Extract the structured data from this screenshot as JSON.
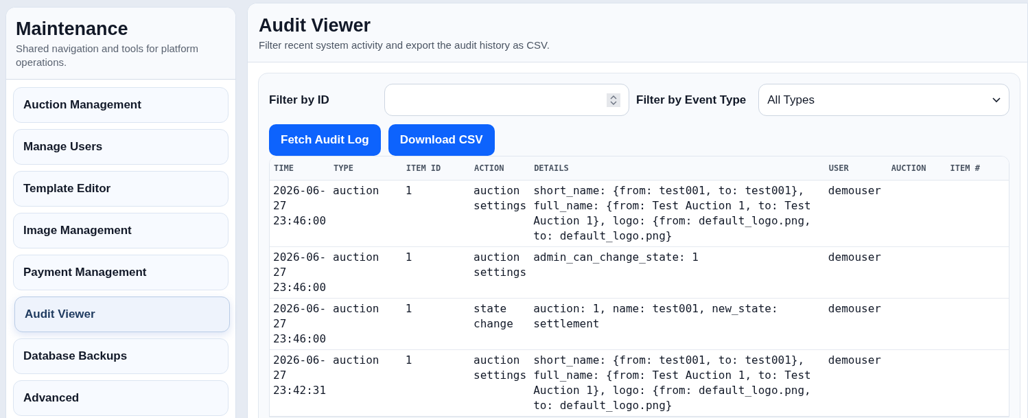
{
  "sidebar": {
    "title": "Maintenance",
    "subtitle": "Shared navigation and tools for platform operations.",
    "items": [
      {
        "label": "Auction Management",
        "selected": false
      },
      {
        "label": "Manage Users",
        "selected": false
      },
      {
        "label": "Template Editor",
        "selected": false
      },
      {
        "label": "Image Management",
        "selected": false
      },
      {
        "label": "Payment Management",
        "selected": false
      },
      {
        "label": "Audit Viewer",
        "selected": true
      },
      {
        "label": "Database Backups",
        "selected": false
      },
      {
        "label": "Advanced",
        "selected": false
      }
    ]
  },
  "page": {
    "title": "Audit Viewer",
    "subtitle": "Filter recent system activity and export the audit history as CSV."
  },
  "filters": {
    "id_label": "Filter by ID",
    "type_label": "Filter by Event Type",
    "type_value": "All Types"
  },
  "buttons": [
    "Fetch Audit Log",
    "Download CSV"
  ],
  "table": {
    "columns": [
      "TIME",
      "TYPE",
      "ITEM ID",
      "ACTION",
      "DETAILS",
      "USER",
      "AUCTION",
      "ITEM #"
    ],
    "rows": [
      [
        "2026-06-27 23:46:00",
        "auction",
        "1",
        "auction settings",
        "short_name: {from: test001, to: test001}, full_name: {from: Test Auction 1, to: Test Auction 1}, logo: {from: default_logo.png, to: default_logo.png}",
        "demouser",
        "",
        ""
      ],
      [
        "2026-06-27 23:46:00",
        "auction",
        "1",
        "auction settings",
        "admin_can_change_state: 1",
        "demouser",
        "",
        ""
      ],
      [
        "2026-06-27 23:46:00",
        "auction",
        "1",
        "state change",
        "auction: 1, name: test001, new_state: settlement",
        "demouser",
        "",
        ""
      ],
      [
        "2026-06-27 23:42:31",
        "auction",
        "1",
        "auction settings",
        "short_name: {from: test001, to: test001}, full_name: {from: Test Auction 1, to: Test Auction 1}, logo: {from: default_logo.png, to: default_logo.png}",
        "demouser",
        "",
        ""
      ]
    ]
  }
}
